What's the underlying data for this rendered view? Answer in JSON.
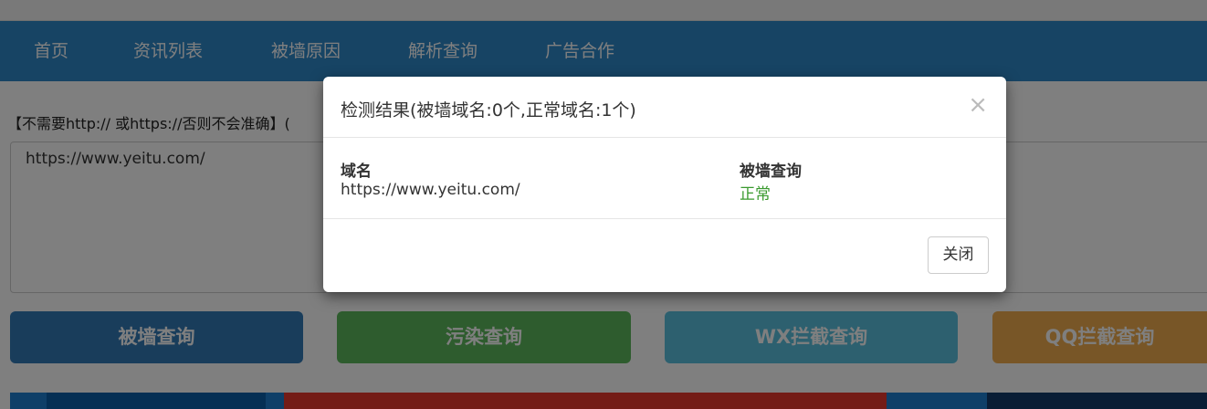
{
  "nav": {
    "items": [
      {
        "label": "首页"
      },
      {
        "label": "资讯列表"
      },
      {
        "label": "被墙原因"
      },
      {
        "label": "解析查询"
      },
      {
        "label": "广告合作"
      }
    ]
  },
  "form": {
    "hint": "【不需要http:// 或https://否则不会准确】(",
    "textarea_value": "https://www.yeitu.com/"
  },
  "buttons": {
    "wall_check": "被墙查询",
    "pollution_check": "污染查询",
    "wx_check": "WX拦截查询",
    "qq_check": "QQ拦截查询"
  },
  "modal": {
    "title": "检测结果(被墙域名:0个,正常域名:1个)",
    "close_symbol": "×",
    "columns": {
      "domain": "域名",
      "status": "被墙查询"
    },
    "row": {
      "domain": "https://www.yeitu.com/",
      "status": "正常"
    },
    "close_button": "关闭"
  },
  "colors": {
    "nav_bg": "#2f88c9",
    "btn_wall": "#337ab7",
    "btn_pollution": "#5cb85c",
    "btn_wx": "#5bc0de",
    "btn_qq": "#f0ad4e",
    "status_ok": "#3a9a2f"
  }
}
